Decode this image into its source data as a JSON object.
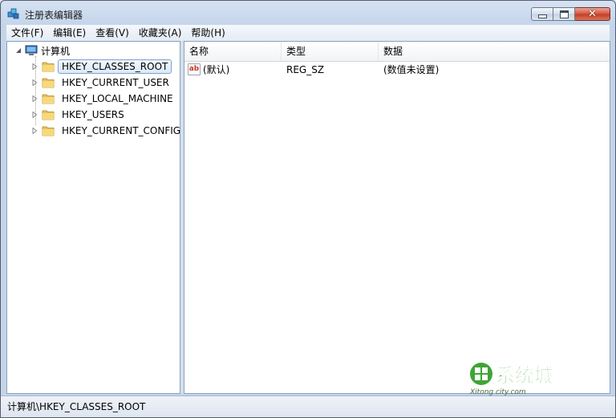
{
  "window": {
    "title": "注册表编辑器"
  },
  "menu": [
    "文件(F)",
    "编辑(E)",
    "查看(V)",
    "收藏夹(A)",
    "帮助(H)"
  ],
  "tree": {
    "root": "计算机",
    "items": [
      {
        "label": "HKEY_CLASSES_ROOT",
        "selected": true
      },
      {
        "label": "HKEY_CURRENT_USER"
      },
      {
        "label": "HKEY_LOCAL_MACHINE"
      },
      {
        "label": "HKEY_USERS"
      },
      {
        "label": "HKEY_CURRENT_CONFIG"
      }
    ]
  },
  "list": {
    "columns": [
      "名称",
      "类型",
      "数据"
    ],
    "rows": [
      {
        "icon": "string-value-icon",
        "icon_text": "ab",
        "name": "(默认)",
        "type": "REG_SZ",
        "data": "(数值未设置)"
      }
    ]
  },
  "status": {
    "path": "计算机\\HKEY_CLASSES_ROOT"
  },
  "watermark": {
    "name": "系统城",
    "site": "Xitong city.com"
  },
  "colors": {
    "accent": "#7da2ce",
    "close": "#c23b21",
    "watermark_green": "#3fa535"
  }
}
